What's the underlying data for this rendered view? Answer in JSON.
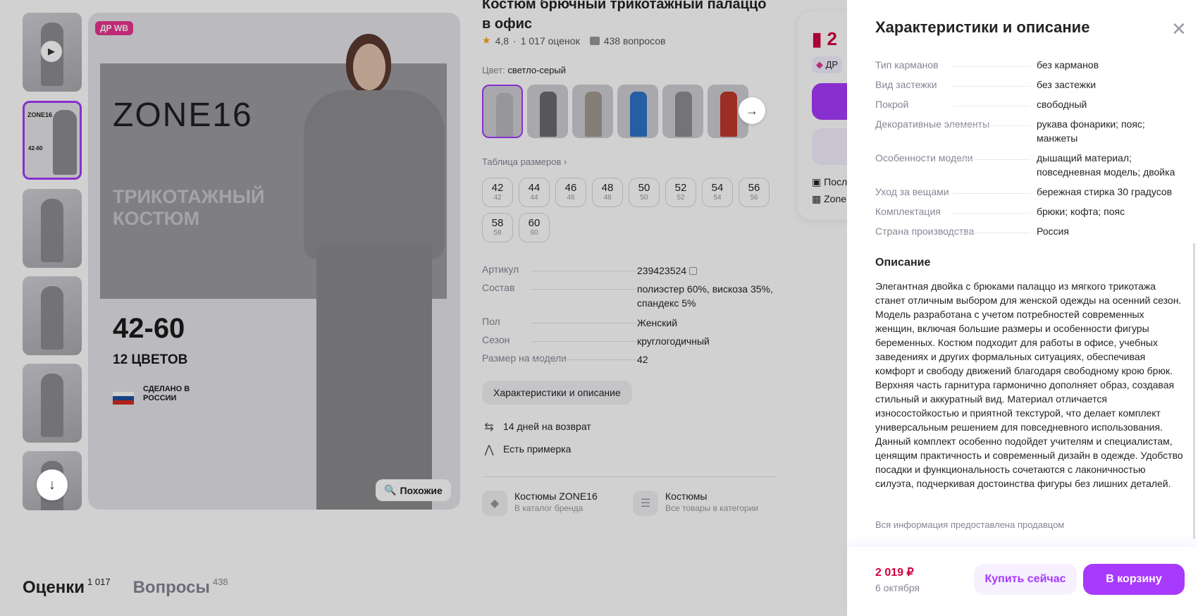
{
  "product": {
    "title": "Костюм брючный трикотажный палаццо в офис",
    "rating": "4,8",
    "reviews": "1 017 оценок",
    "questions": "438 вопросов",
    "color_label": "Цвет:",
    "color_value": "светло-серый",
    "size_table_link": "Таблица размеров",
    "sizes": [
      {
        "ru": "42",
        "eu": "42"
      },
      {
        "ru": "44",
        "eu": "44"
      },
      {
        "ru": "46",
        "eu": "46"
      },
      {
        "ru": "48",
        "eu": "48"
      },
      {
        "ru": "50",
        "eu": "50"
      },
      {
        "ru": "52",
        "eu": "52"
      },
      {
        "ru": "54",
        "eu": "54"
      },
      {
        "ru": "56",
        "eu": "56"
      },
      {
        "ru": "58",
        "eu": "58"
      },
      {
        "ru": "60",
        "eu": "60"
      }
    ],
    "specs": [
      {
        "k": "Артикул",
        "v": "239423524"
      },
      {
        "k": "Состав",
        "v": "полиэстер 60%, вискоза 35%, спандекс 5%"
      },
      {
        "k": "Пол",
        "v": "Женский"
      },
      {
        "k": "Сезон",
        "v": "круглогодичный"
      },
      {
        "k": "Размер на модели",
        "v": "42"
      }
    ],
    "char_button": "Характеристики и описание",
    "perks": [
      "14 дней на возврат",
      "Есть примерка"
    ],
    "categories": [
      {
        "title": "Костюмы ZONE16",
        "sub": "В каталог бренда"
      },
      {
        "title": "Костюмы",
        "sub": "Все товары в категории"
      }
    ],
    "swatch_colors": [
      "#b9b9bd",
      "#6b6b70",
      "#a39a90",
      "#2f73c9",
      "#8e8e92",
      "#c0392b"
    ]
  },
  "gallery": {
    "badge": "ДР WB",
    "brand": "ZONE16",
    "headline": "ТРИКОТАЖНЫЙ КОСТЮМ",
    "sizes": "42-60",
    "colors": "12 ЦВЕТОВ",
    "made_in": "СДЕЛАНО В РОССИИ",
    "similar_button": "Похожие"
  },
  "buy_card": {
    "price_partial": "2",
    "dr_partial": "ДР",
    "row1": "Посл",
    "row2": "Zone"
  },
  "tabs": [
    {
      "label": "Оценки",
      "count": "1 017"
    },
    {
      "label": "Вопросы",
      "count": "438"
    }
  ],
  "drawer": {
    "title": "Характеристики и описание",
    "specs": [
      {
        "k": "Тип карманов",
        "v": "без карманов"
      },
      {
        "k": "Вид застежки",
        "v": "без застежки"
      },
      {
        "k": "Покрой",
        "v": "свободный"
      },
      {
        "k": "Декоративные элементы",
        "v": "рукава фонарики; пояс; манжеты"
      },
      {
        "k": "Особенности модели",
        "v": "дышащий материал; повседневная модель; двойка"
      },
      {
        "k": "Уход за вещами",
        "v": "бережная стирка 30 градусов"
      },
      {
        "k": "Комплектация",
        "v": "брюки; кофта; пояс"
      },
      {
        "k": "Страна производства",
        "v": "Россия"
      }
    ],
    "desc_heading": "Описание",
    "description": "Элегантная двойка с брюками палаццо из мягкого трикотажа станет отличным выбором для женской одежды на осенний сезон. Модель разработана с учетом потребностей современных женщин, включая большие размеры и особенности фигуры беременных. Костюм подходит для работы в офисе, учебных заведениях и других формальных ситуациях, обеспечивая комфорт и свободу движений благодаря свободному крою брюк. Верхняя часть гарнитура гармонично дополняет образ, создавая стильный и аккуратный вид. Материал отличается износостойкостью и приятной текстурой, что делает комплект универсальным решением для повседневного использования. Данный комплект особенно подойдет учителям и специалистам, ценящим практичность и современный дизайн в одежде. Удобство посадки и функциональность сочетаются с лаконичностью силуэта, подчеркивая достоинства фигуры без лишних деталей.",
    "note": "Вся информация предоставлена продавцом",
    "footer": {
      "price": "2 019 ₽",
      "date": "6 октября",
      "buy_now": "Купить сейчас",
      "to_cart": "В корзину"
    }
  },
  "colors": {
    "accent": "#a73afd",
    "price": "#d1003f",
    "badge": "#e8358f"
  }
}
